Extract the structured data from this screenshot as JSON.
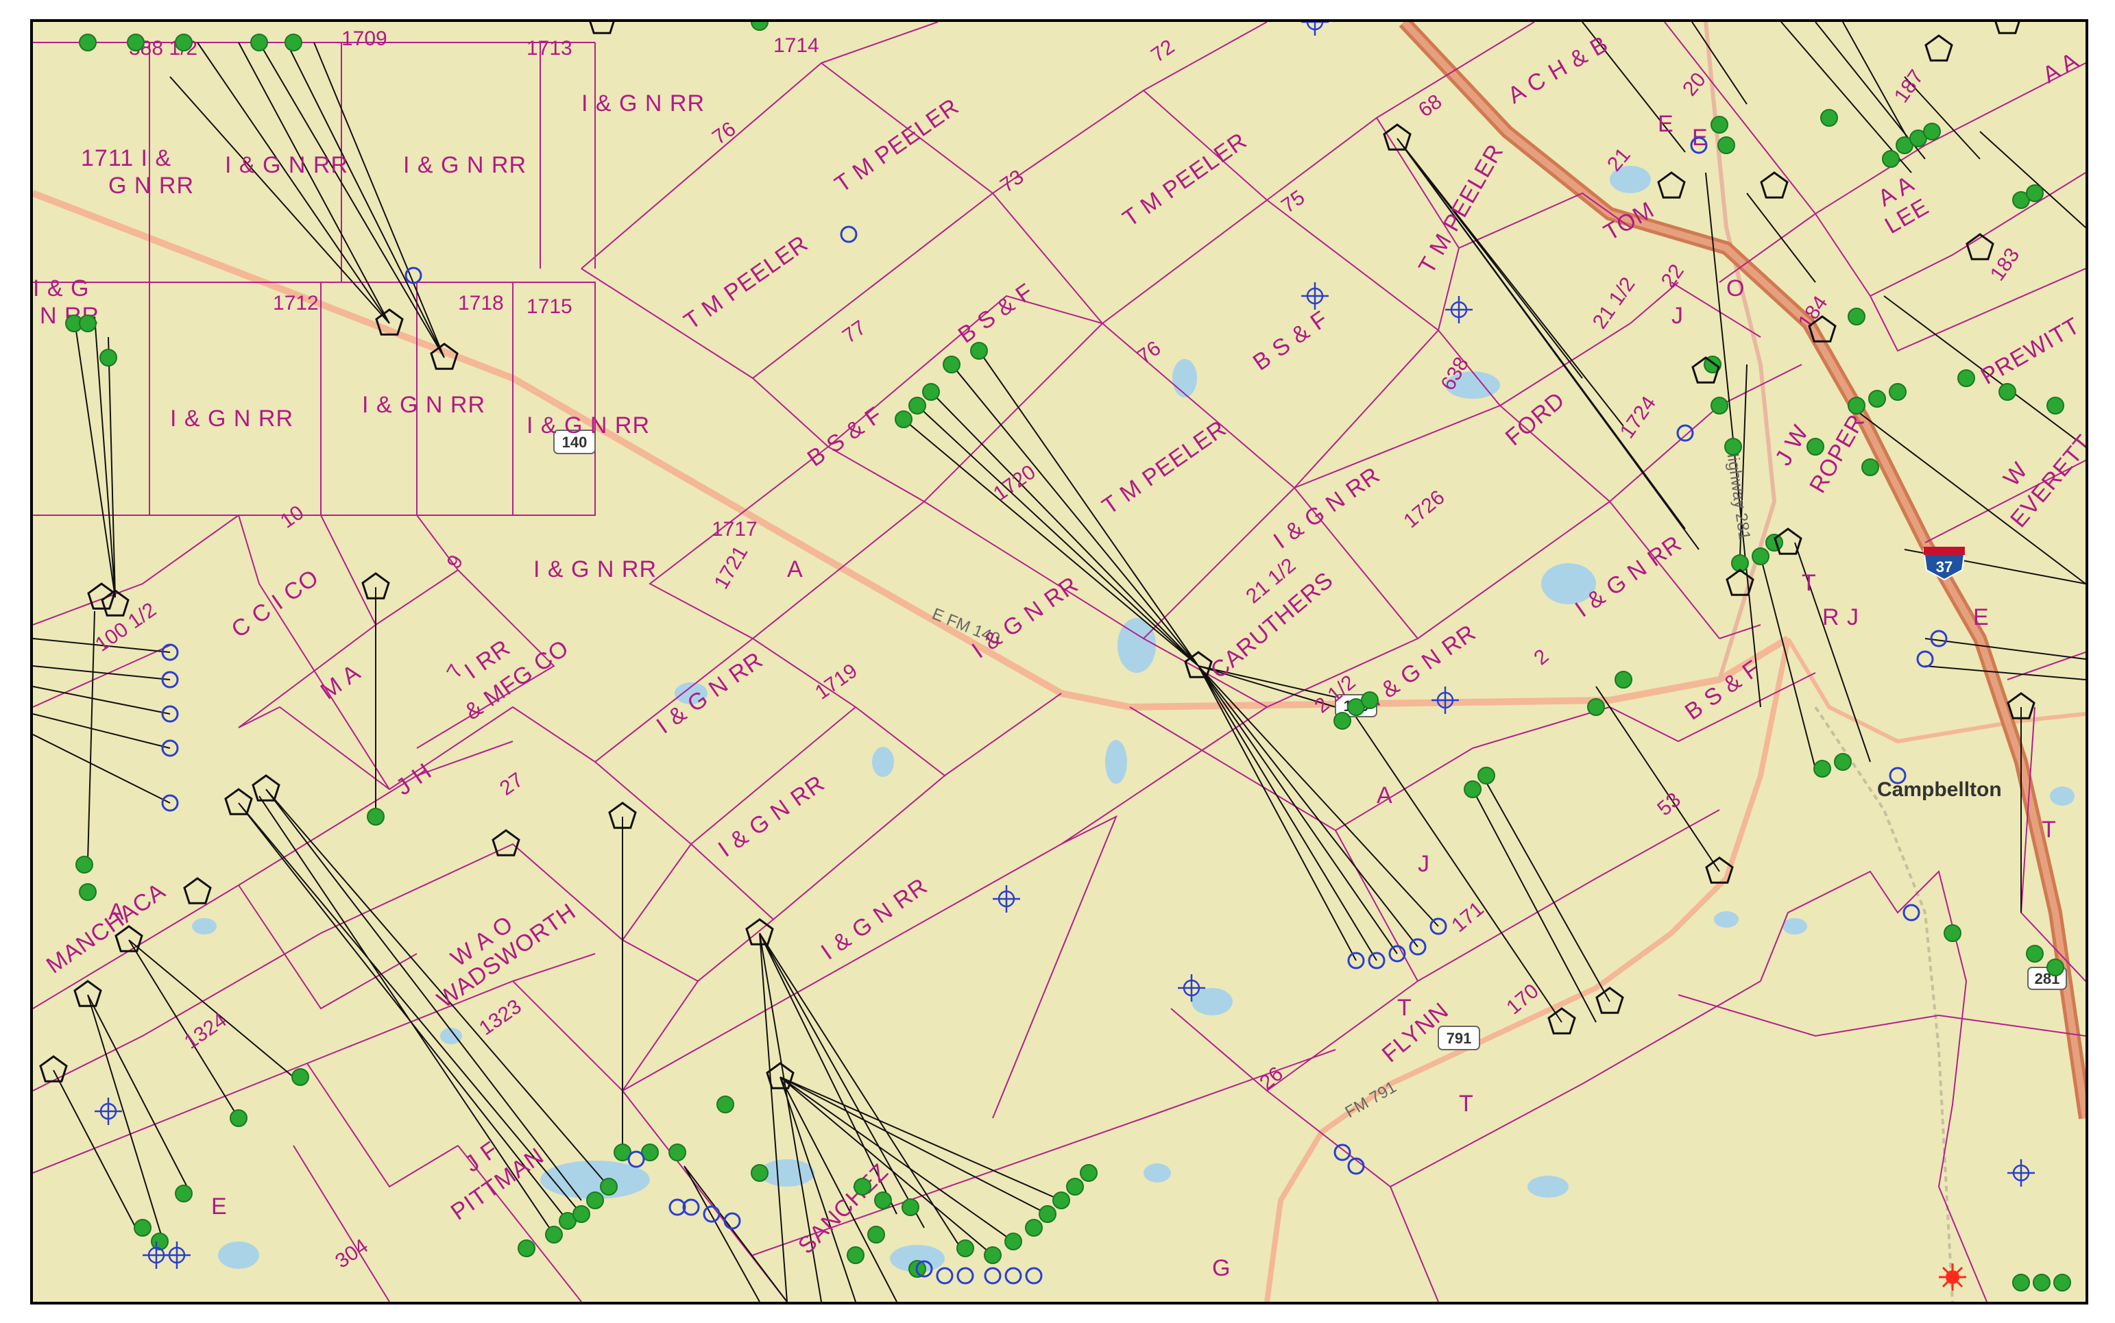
{
  "map": {
    "place_labels": [
      {
        "text": "Campbellton"
      }
    ],
    "road_labels": [
      {
        "text": "E FM 140"
      },
      {
        "text": "FM 791"
      },
      {
        "text": "Highway 281"
      }
    ],
    "shields": [
      {
        "text": "140"
      },
      {
        "text": "791"
      },
      {
        "text": "37"
      },
      {
        "text": "281"
      },
      {
        "text": "140"
      }
    ],
    "tract_labels": [
      {
        "text": "1711 I &"
      },
      {
        "text": "G N RR"
      },
      {
        "text": "I & G N RR"
      },
      {
        "text": "I & G N RR"
      },
      {
        "text": "I & G N RR"
      },
      {
        "text": "T M PEELER"
      },
      {
        "text": "T M PEELER"
      },
      {
        "text": "T M PEELER"
      },
      {
        "text": "T M PEELER"
      },
      {
        "text": "T M PEELER"
      },
      {
        "text": "B S & F"
      },
      {
        "text": "B S & F"
      },
      {
        "text": "B S & F"
      },
      {
        "text": "B S & F"
      },
      {
        "text": "I & G N RR"
      },
      {
        "text": "I & G N RR"
      },
      {
        "text": "I & G N RR"
      },
      {
        "text": "I & G N RR"
      },
      {
        "text": "I & G N RR"
      },
      {
        "text": "I & G N RR"
      },
      {
        "text": "I & G N RR"
      },
      {
        "text": "I & G N RR"
      },
      {
        "text": "I & G N RR"
      },
      {
        "text": "I & G N RR"
      },
      {
        "text": "I & G N RR"
      },
      {
        "text": "I & G"
      },
      {
        "text": "N RR"
      },
      {
        "text": "C C I CO"
      },
      {
        "text": "M A"
      },
      {
        "text": "J H"
      },
      {
        "text": "I RR"
      },
      {
        "text": "& MFG CO"
      },
      {
        "text": "W A O"
      },
      {
        "text": "WADSWORTH"
      },
      {
        "text": "MANCHACA"
      },
      {
        "text": "J F"
      },
      {
        "text": "PITTMAN"
      },
      {
        "text": "SANCHEZ"
      },
      {
        "text": "CARUTHERS"
      },
      {
        "text": "FORD"
      },
      {
        "text": "A C H & B"
      },
      {
        "text": "TOM"
      },
      {
        "text": "A A"
      },
      {
        "text": "LEE"
      },
      {
        "text": "PREWITT"
      },
      {
        "text": "J W"
      },
      {
        "text": "ROPER"
      },
      {
        "text": "W"
      },
      {
        "text": "EVERETT"
      },
      {
        "text": "T"
      },
      {
        "text": "FLYNN"
      },
      {
        "text": "T"
      },
      {
        "text": "A"
      },
      {
        "text": "A"
      },
      {
        "text": "E"
      },
      {
        "text": "E"
      },
      {
        "text": "E"
      },
      {
        "text": "J"
      },
      {
        "text": "J"
      },
      {
        "text": "G"
      },
      {
        "text": "O"
      },
      {
        "text": "A A"
      },
      {
        "text": "E"
      },
      {
        "text": "R J"
      },
      {
        "text": "T"
      },
      {
        "text": "T"
      },
      {
        "text": "A"
      }
    ],
    "tract_numbers": [
      {
        "text": "388 1/2"
      },
      {
        "text": "1709"
      },
      {
        "text": "1713"
      },
      {
        "text": "1714"
      },
      {
        "text": "72"
      },
      {
        "text": "76"
      },
      {
        "text": "73"
      },
      {
        "text": "75"
      },
      {
        "text": "1712"
      },
      {
        "text": "1718"
      },
      {
        "text": "1715"
      },
      {
        "text": "77"
      },
      {
        "text": "76"
      },
      {
        "text": "68"
      },
      {
        "text": "20"
      },
      {
        "text": "21"
      },
      {
        "text": "21 1/2"
      },
      {
        "text": "22"
      },
      {
        "text": "187"
      },
      {
        "text": "184"
      },
      {
        "text": "183"
      },
      {
        "text": "638"
      },
      {
        "text": "1720"
      },
      {
        "text": "1717"
      },
      {
        "text": "1721"
      },
      {
        "text": "1726"
      },
      {
        "text": "1724"
      },
      {
        "text": "21 1/2"
      },
      {
        "text": "10"
      },
      {
        "text": "100 1/2"
      },
      {
        "text": "9"
      },
      {
        "text": "7"
      },
      {
        "text": "27"
      },
      {
        "text": "1719"
      },
      {
        "text": "2 1/2"
      },
      {
        "text": "2"
      },
      {
        "text": "53"
      },
      {
        "text": "171"
      },
      {
        "text": "170"
      },
      {
        "text": "1324"
      },
      {
        "text": "1323"
      },
      {
        "text": "26"
      },
      {
        "text": "304"
      }
    ]
  }
}
